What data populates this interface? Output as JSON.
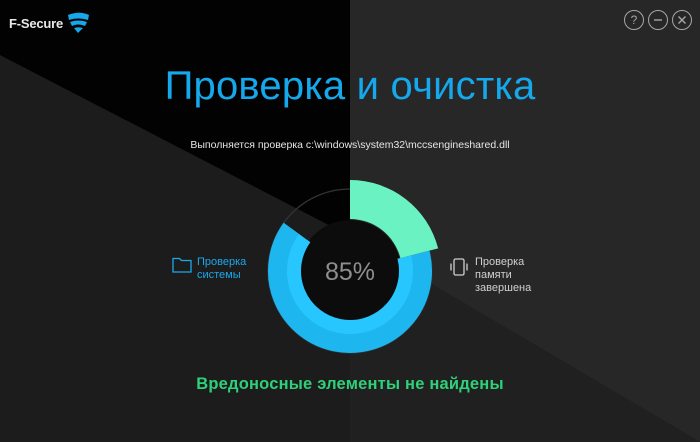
{
  "brand": {
    "name": "F-Secure",
    "logo_icon": "f-secure-shield-icon",
    "logo_color": "#15a8ec"
  },
  "window_controls": {
    "help": {
      "icon": "question-icon",
      "glyph": "?"
    },
    "minimize": {
      "icon": "minimize-icon"
    },
    "close": {
      "icon": "close-icon"
    }
  },
  "header": {
    "title": "Проверка и очистка",
    "scan_status": "Выполняется проверка c:\\windows\\system32\\mccsengineshared.dll"
  },
  "progress": {
    "percent_label": "85%",
    "fraction": 0.85,
    "memory_segment_fraction": 0.21,
    "colors": {
      "outer": "#1eb6ef",
      "inner": "#27c6ff",
      "memory": "#6af2c3",
      "track": "#2f3438",
      "text": "#8e8e8e"
    }
  },
  "stages": [
    {
      "icon": "folder-icon",
      "line1": "Проверка",
      "line2": "системы",
      "state": "active"
    },
    {
      "icon": "memory-phone-icon",
      "line1": "Проверка",
      "line2": "памяти",
      "line3": "завершена",
      "state": "done"
    }
  ],
  "result": {
    "text": "Вредоносные элементы не найдены",
    "color": "#2fd07a"
  },
  "theme": {
    "accent": "#15a8ec",
    "bg_dark": "#000000",
    "bg_gray": "#262626"
  }
}
